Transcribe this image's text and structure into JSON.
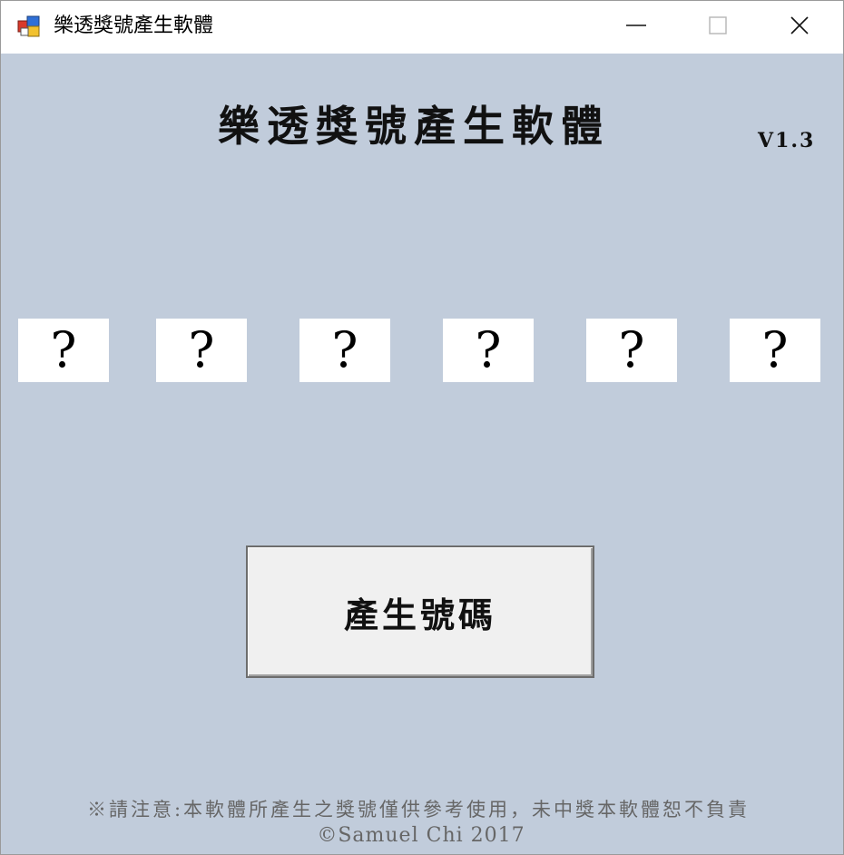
{
  "window": {
    "title": "樂透獎號產生軟體",
    "icon": "windows-forms-app-icon",
    "controls": {
      "minimize_icon": "minimize-icon",
      "maximize_icon": "maximize-icon",
      "close_icon": "close-icon"
    }
  },
  "main": {
    "heading": "樂透獎號產生軟體",
    "version": "V1.3",
    "numbers": [
      "?",
      "?",
      "?",
      "?",
      "?",
      "?"
    ],
    "generate_button_label": "產生號碼",
    "notice": "※請注意:本軟體所產生之獎號僅供參考使用，未中獎本軟體恕不負責",
    "copyright": "©Samuel Chi 2017"
  },
  "colors": {
    "client_background": "#c1ccdb",
    "titlebar_background": "#ffffff",
    "number_box_background": "#ffffff",
    "button_background": "#f0f0f0",
    "footer_text": "#666666"
  }
}
